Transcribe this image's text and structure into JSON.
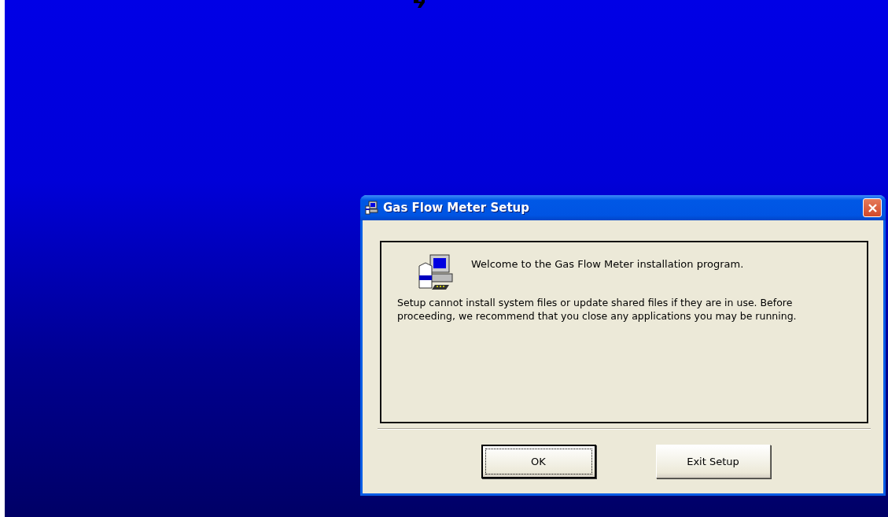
{
  "window": {
    "title": "Gas Flow Meter Setup"
  },
  "message": {
    "welcome": "Welcome to the Gas Flow Meter installation program.",
    "body": "Setup cannot install system files or update shared files if they are in use. Before proceeding, we recommend that you close any applications you may be running."
  },
  "buttons": [
    {
      "label": "OK",
      "default": true
    },
    {
      "label": "Exit Setup",
      "default": false
    }
  ]
}
